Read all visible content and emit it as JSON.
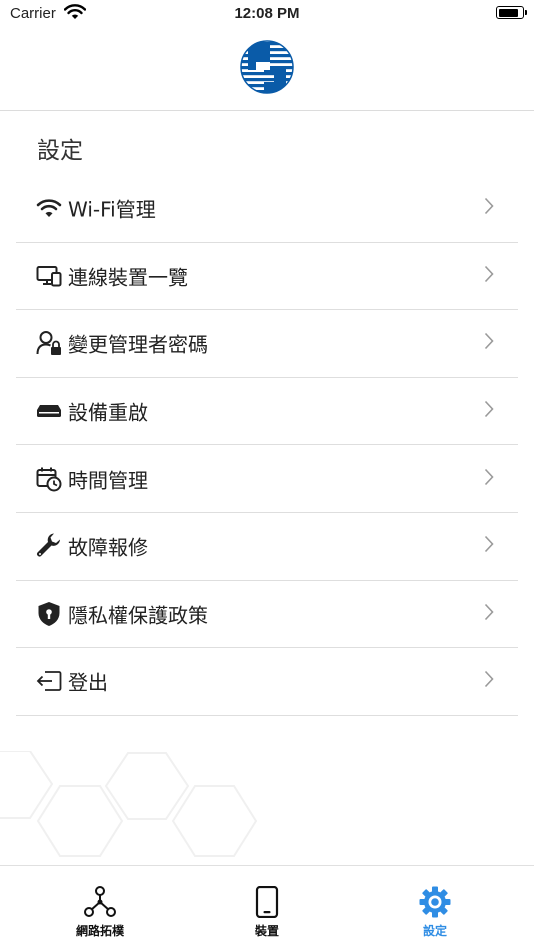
{
  "status_bar": {
    "carrier": "Carrier",
    "time": "12:08 PM",
    "battery_level": 0.9
  },
  "header": {
    "logo_icon": "cht-logo-icon"
  },
  "page": {
    "title": "設定"
  },
  "menu": {
    "items": [
      {
        "label": "Wi-Fi管理",
        "icon": "wifi-icon"
      },
      {
        "label": "連線裝置一覽",
        "icon": "devices-icon"
      },
      {
        "label": "變更管理者密碼",
        "icon": "admin-lock-icon"
      },
      {
        "label": "設備重啟",
        "icon": "router-icon"
      },
      {
        "label": "時間管理",
        "icon": "calendar-clock-icon"
      },
      {
        "label": "故障報修",
        "icon": "wrench-icon"
      },
      {
        "label": "隱私權保護政策",
        "icon": "shield-lock-icon"
      },
      {
        "label": "登出",
        "icon": "logout-icon"
      }
    ]
  },
  "tab_bar": {
    "active_color": "#2f8de4",
    "tabs": [
      {
        "label": "網路拓樸",
        "icon": "network-topology-icon",
        "active": false
      },
      {
        "label": "裝置",
        "icon": "phone-icon",
        "active": false
      },
      {
        "label": "設定",
        "icon": "gear-icon",
        "active": true
      }
    ]
  }
}
